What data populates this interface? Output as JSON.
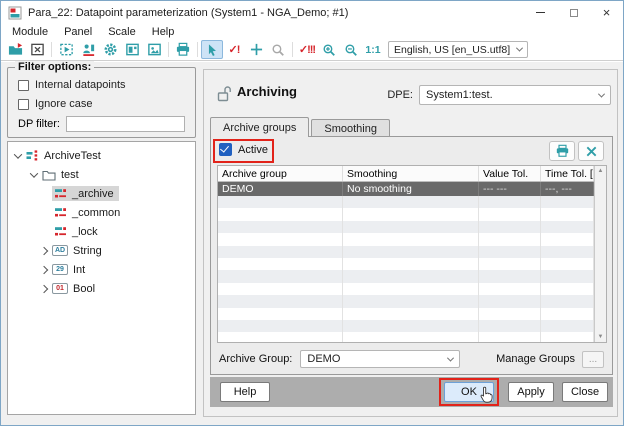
{
  "window": {
    "title": "Para_22: Datapoint parameterization (System1 - NGA_Demo; #1)"
  },
  "menu": {
    "items": [
      "Module",
      "Panel",
      "Scale",
      "Help"
    ]
  },
  "toolbar": {
    "language": "English, US [en_US.utf8]",
    "zoom_ratio": "1:1"
  },
  "icons": {
    "correct": "✓!",
    "correct_all": "✓!!!",
    "scroll_up": "▲",
    "scroll_down": "▼"
  },
  "filter": {
    "title": "Filter options:",
    "internal_datapoints_label": "Internal datapoints",
    "internal_datapoints_checked": false,
    "ignore_case_label": "Ignore case",
    "ignore_case_checked": false,
    "dp_filter_label": "DP filter:",
    "dp_filter_value": ""
  },
  "tree": {
    "items": [
      {
        "label": "ArchiveTest",
        "level": 0,
        "expanded": true,
        "icon": "datapoint-type"
      },
      {
        "label": "test",
        "level": 1,
        "expanded": true,
        "icon": "folder"
      },
      {
        "label": "_archive",
        "level": 2,
        "icon": "config",
        "selected": true
      },
      {
        "label": "_common",
        "level": 2,
        "icon": "config"
      },
      {
        "label": "_lock",
        "level": 2,
        "icon": "config"
      },
      {
        "label": "String",
        "level": 2,
        "expanded": false,
        "badge": "AD"
      },
      {
        "label": "Int",
        "level": 2,
        "expanded": false,
        "badge": "29"
      },
      {
        "label": "Bool",
        "level": 2,
        "expanded": false,
        "badge": "01"
      }
    ]
  },
  "panel": {
    "title": "Archiving",
    "dpe_label": "DPE:",
    "dpe_value": "System1:test.",
    "tabs": [
      {
        "label": "Archive groups",
        "active": true
      },
      {
        "label": "Smoothing",
        "active": false
      }
    ],
    "active_checkbox_label": "Active",
    "active_checked": true,
    "table": {
      "columns": [
        "Archive group",
        "Smoothing",
        "Value Tol.",
        "Time Tol. [s]"
      ],
      "rows": [
        [
          "DEMO",
          "No smoothing",
          "--- ---",
          "---, ---"
        ]
      ],
      "selected_row": 0,
      "empty_row_count": 12
    },
    "archive_group_label": "Archive Group:",
    "archive_group_value": "DEMO",
    "manage_groups_label": "Manage Groups",
    "manage_groups_button": "...",
    "buttons": {
      "help": "Help",
      "ok": "OK",
      "apply": "Apply",
      "close": "Close"
    }
  },
  "colors": {
    "accent_teal": "#2f9ea8",
    "accent_red": "#d6262c",
    "annotation_red": "#e2231a",
    "checkbox_blue": "#2060c0",
    "selected_row_bg": "#696969",
    "button_bar_bg": "#adadad",
    "ok_button_bg": "#dcebfb"
  }
}
